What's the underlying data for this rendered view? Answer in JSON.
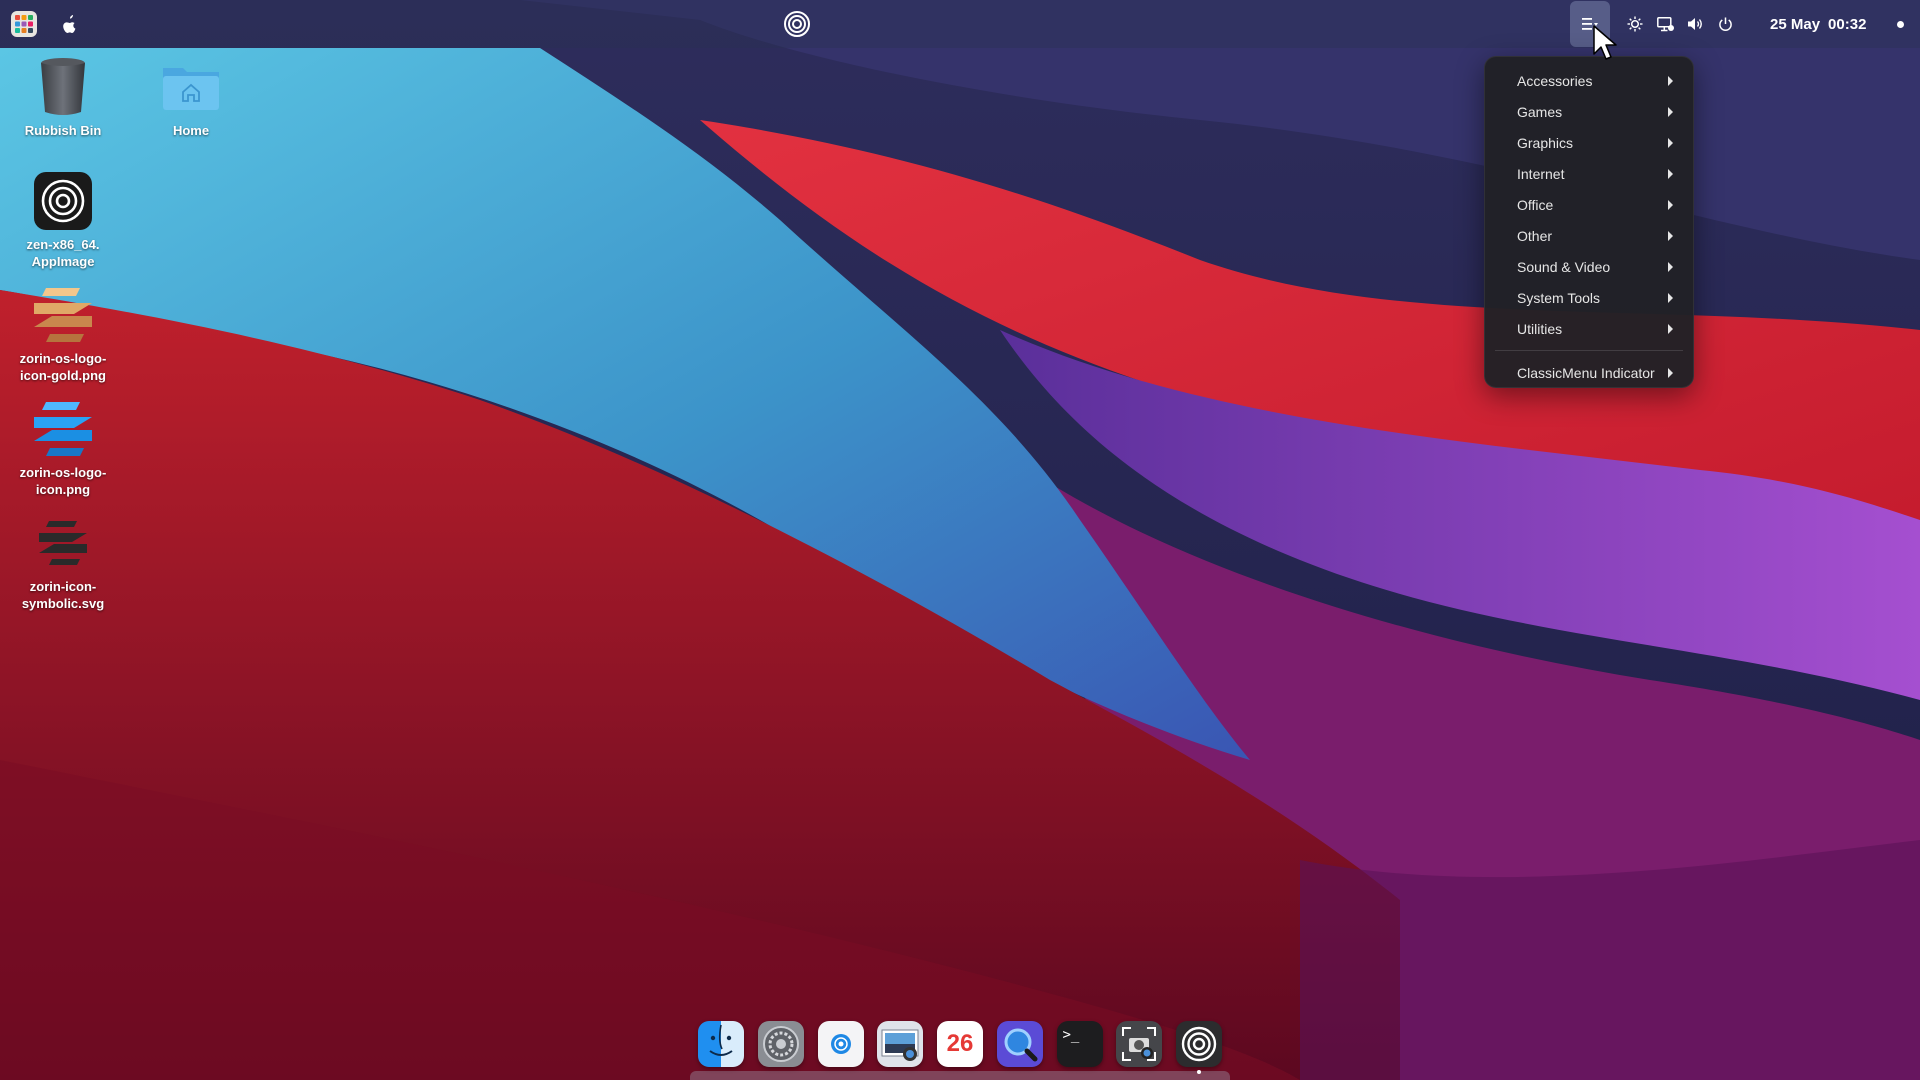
{
  "topbar": {
    "apps_icon": "apps-grid-icon",
    "apple_icon": "apple-icon",
    "center_app_icon": "zen-browser-icon",
    "menu_button_icon": "classicmenu-icon",
    "tray": [
      "brightness-icon",
      "display-icon",
      "volume-icon",
      "power-icon"
    ],
    "date": "25 May",
    "time": "00:32"
  },
  "desktop": {
    "icons": [
      {
        "label": "Rubbish Bin",
        "icon": "trash-icon"
      },
      {
        "label": "Home",
        "icon": "home-folder-icon"
      },
      {
        "label": "zen-x86_64.\nAppImage",
        "icon": "zen-appimage-icon"
      },
      {
        "label": "zorin-os-logo-\nicon-gold.png",
        "icon": "zorin-gold-icon"
      },
      {
        "label": "zorin-os-logo-\nicon.png",
        "icon": "zorin-blue-icon"
      },
      {
        "label": "zorin-icon-\nsymbolic.svg",
        "icon": "zorin-symbolic-icon"
      }
    ]
  },
  "menu": {
    "items": [
      {
        "label": "Accessories"
      },
      {
        "label": "Games"
      },
      {
        "label": "Graphics"
      },
      {
        "label": "Internet"
      },
      {
        "label": "Office"
      },
      {
        "label": "Other"
      },
      {
        "label": "Sound & Video"
      },
      {
        "label": "System Tools"
      },
      {
        "label": "Utilities"
      }
    ],
    "footer_item": {
      "label": "ClassicMenu Indicator"
    }
  },
  "dock": {
    "apps": [
      {
        "icon": "finder-icon"
      },
      {
        "icon": "settings-icon"
      },
      {
        "icon": "browser-icon"
      },
      {
        "icon": "image-viewer-icon"
      },
      {
        "icon": "calendar-icon",
        "text": "26"
      },
      {
        "icon": "search-app-icon"
      },
      {
        "icon": "terminal-icon",
        "text": ">_"
      },
      {
        "icon": "screenshot-icon"
      },
      {
        "icon": "zen-browser-icon"
      }
    ]
  },
  "colors": {
    "menu_bg": "#212126",
    "accent_red": "#e53935",
    "text": "#e6e6e6"
  }
}
